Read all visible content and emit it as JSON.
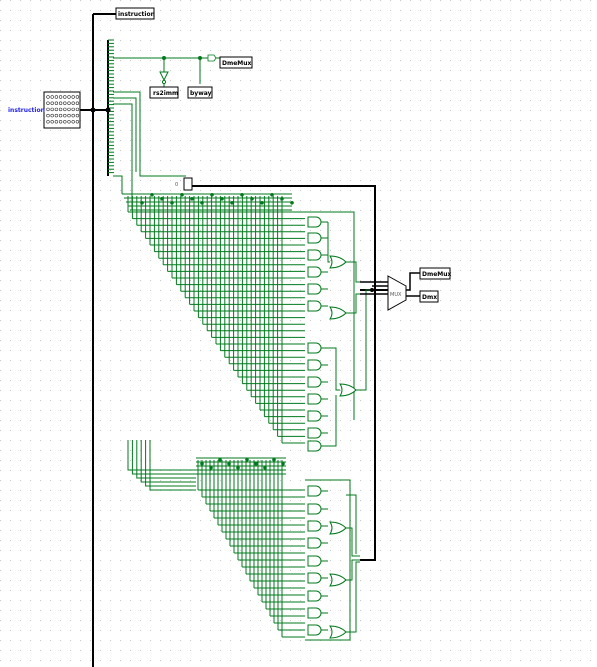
{
  "pins": {
    "instruction_out": "instruction",
    "instruction_in": "instruction",
    "rs2imm": "rs2imm",
    "byway": "byway",
    "dmemux_top": "DmeMux",
    "dmemux_right": "DmeMux",
    "dmx": "Dmx"
  },
  "mux": {
    "label": "MUX"
  },
  "colors": {
    "wire_active": "#007a1c",
    "wire_bus": "#000000",
    "input_label": "#2222ee",
    "grid_dot": "#c8c8c8"
  }
}
